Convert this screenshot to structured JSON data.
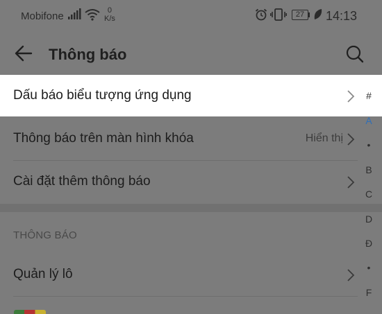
{
  "status_bar": {
    "carrier": "Mobifone",
    "speed_value": "0",
    "speed_unit": "K/s",
    "battery": "27",
    "time": "14:13"
  },
  "header": {
    "title": "Thông báo",
    "icons": [
      "back-arrow-icon",
      "search-icon"
    ]
  },
  "settings": {
    "rows": [
      {
        "label": "Dấu báo biểu tượng ứng dụng"
      },
      {
        "label": "Thông báo trên màn hình khóa",
        "value": "Hiển thị"
      },
      {
        "label": "Cài đặt thêm thông báo"
      }
    ],
    "section_header": "THÔNG BÁO",
    "section_rows": [
      {
        "label": "Quản lý lô"
      }
    ]
  },
  "alpha_index": [
    "#",
    "A",
    "•",
    "B",
    "C",
    "D",
    "Đ",
    "•",
    "F"
  ],
  "colors": {
    "dim_overlay_bg": "#7c7c7c",
    "highlight_bg": "#ffffff",
    "index_active": "#2f6fb8"
  }
}
